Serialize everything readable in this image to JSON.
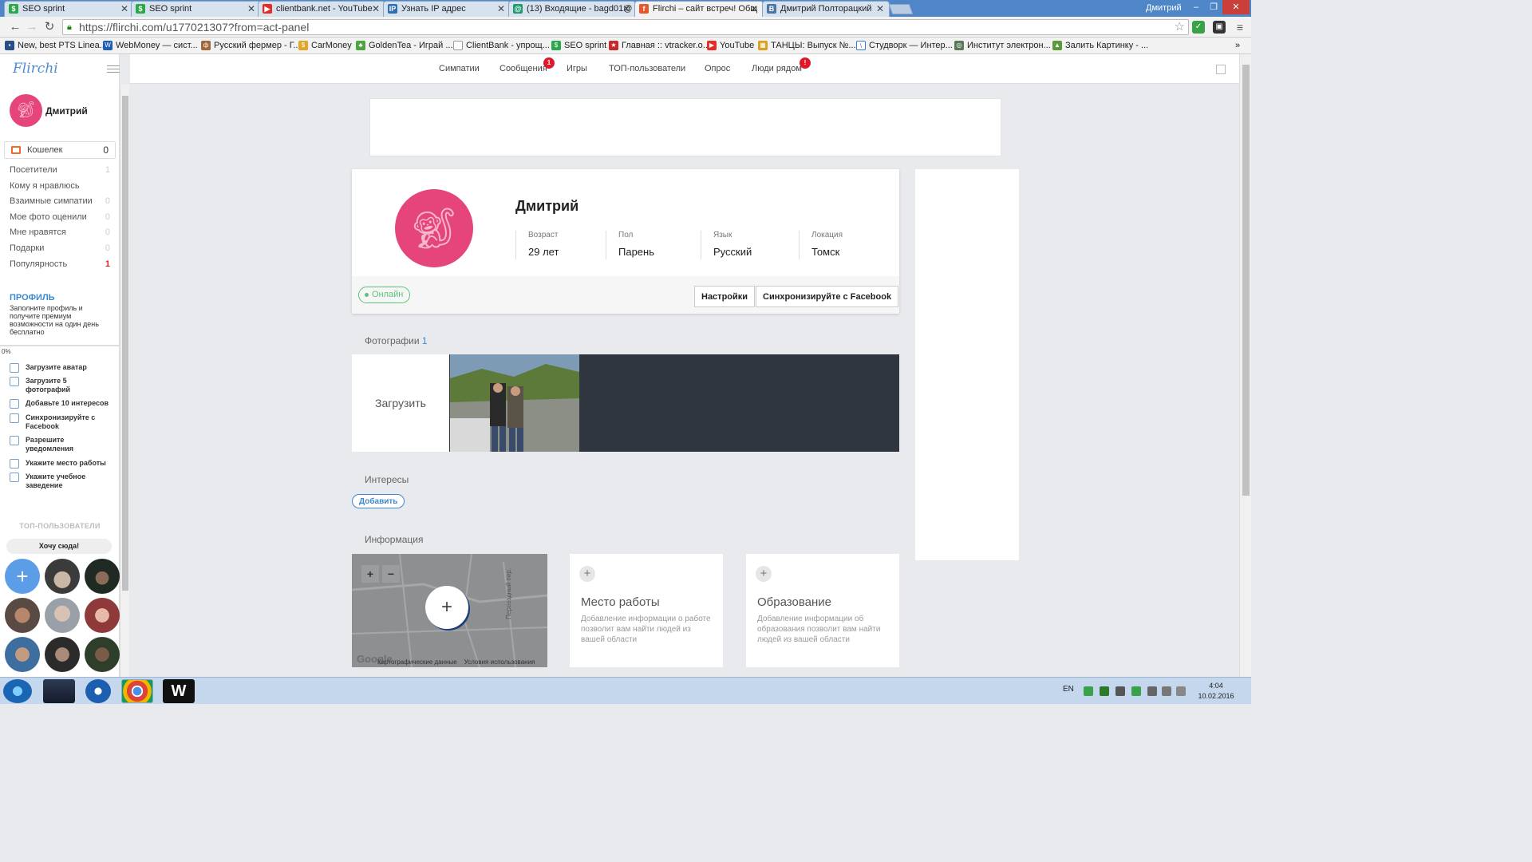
{
  "browser": {
    "tabs": [
      {
        "title": "SEO sprint",
        "icon": "seo-sprint-icon",
        "color": "#2aa84a"
      },
      {
        "title": "SEO sprint",
        "icon": "seo-sprint-icon",
        "color": "#2aa84a"
      },
      {
        "title": "clientbank.net - YouTube",
        "icon": "youtube-icon",
        "color": "#e52d27"
      },
      {
        "title": "Узнать IP адрес",
        "icon": "ip-icon",
        "color": "#2f6fb3"
      },
      {
        "title": "(13) Входящие - bagd01@",
        "icon": "mail-icon",
        "color": "#1f9a6a"
      },
      {
        "title": "Flirchi – сайт встреч! Общ",
        "icon": "flirchi-icon",
        "color": "#e8562c"
      },
      {
        "title": "Дмитрий Полторацкий",
        "icon": "vk-icon",
        "color": "#4a76a8"
      }
    ],
    "profile_chip": "Дмитрий",
    "url": "https://flirchi.com/u177021307?from=act-panel",
    "bookmarks": [
      "New, best PTS Linea...",
      "WebMoney — сист...",
      "Русский фермер - Г...",
      "CarMoney",
      "GoldenTea - Играй ...",
      "ClientBank - упрощ...",
      "SEO sprint",
      "Главная :: vtracker.o...",
      "YouTube",
      "ТАНЦЫ: Выпуск №...",
      "Студворк — Интер...",
      "Институт электрон...",
      "Залить Картинку - ..."
    ],
    "bookmarks_more": "»"
  },
  "sidebar": {
    "logo": "Flirchi",
    "user_name": "Дмитрий",
    "wallet_label": "Кошелек",
    "wallet_count": "0",
    "stats": [
      {
        "label": "Посетители",
        "value": "1"
      },
      {
        "label": "Кому я нравлюсь",
        "value": ""
      },
      {
        "label": "Взаимные симпатии",
        "value": "0"
      },
      {
        "label": "Мое фото оценили",
        "value": "0"
      },
      {
        "label": "Мне нравятся",
        "value": "0"
      },
      {
        "label": "Подарки",
        "value": "0"
      },
      {
        "label": "Популярность",
        "value": "1"
      }
    ],
    "profile_heading": "ПРОФИЛЬ",
    "profile_desc": "Заполните профиль и получите премиум возможности на один день бесплатно",
    "progress_percent": 0,
    "progress_label": "0%",
    "tasks": [
      "Загрузите аватар",
      "Загрузите 5 фотографий",
      "Добавьте 10 интересов",
      "Синхронизируйте с Facebook",
      "Разрешите уведомления",
      "Укажите место работы",
      "Укажите учебное заведение"
    ],
    "top_users_title": "ТОП-ПОЛЬЗОВАТЕЛИ",
    "want_here": "Хочу сюда!"
  },
  "topnav": {
    "items": [
      "Симпатии",
      "Сообщения",
      "Игры",
      "ТОП-пользователи",
      "Опрос",
      "Люди рядом"
    ],
    "messages_badge": "1",
    "nearby_badge": "!"
  },
  "profile": {
    "name": "Дмитрий",
    "fields": [
      {
        "label": "Возраст",
        "value": "29 лет"
      },
      {
        "label": "Пол",
        "value": "Парень"
      },
      {
        "label": "Язык",
        "value": "Русский"
      },
      {
        "label": "Локация",
        "value": "Томск"
      }
    ],
    "status": "Онлайн",
    "settings_button": "Настройки",
    "facebook_button": "Синхронизируйте с Facebook"
  },
  "photos": {
    "title": "Фотографии",
    "count": "1",
    "upload_label": "Загрузить"
  },
  "interests": {
    "title": "Интересы",
    "add_button": "Добавить"
  },
  "info": {
    "title": "Информация",
    "map_zoom_in": "+",
    "map_zoom_out": "−",
    "map_add": "+",
    "map_data": "Картографические данные",
    "map_terms": "Условия использования",
    "map_google": "Google",
    "street_label": "Переездный пер.",
    "work_title": "Место работы",
    "work_desc": "Добавление информации о работе позволит вам найти людей из вашей области",
    "edu_title": "Образование",
    "edu_desc": "Добавление информации об образования позволит вам найти людей из вашей области"
  },
  "taskbar": {
    "lang": "EN",
    "time": "4:04",
    "date": "10.02.2016"
  },
  "colors": {
    "accent": "#3c88cf",
    "avatar": "#e5457a",
    "online": "#5cc37a",
    "badge": "#e0192a"
  }
}
